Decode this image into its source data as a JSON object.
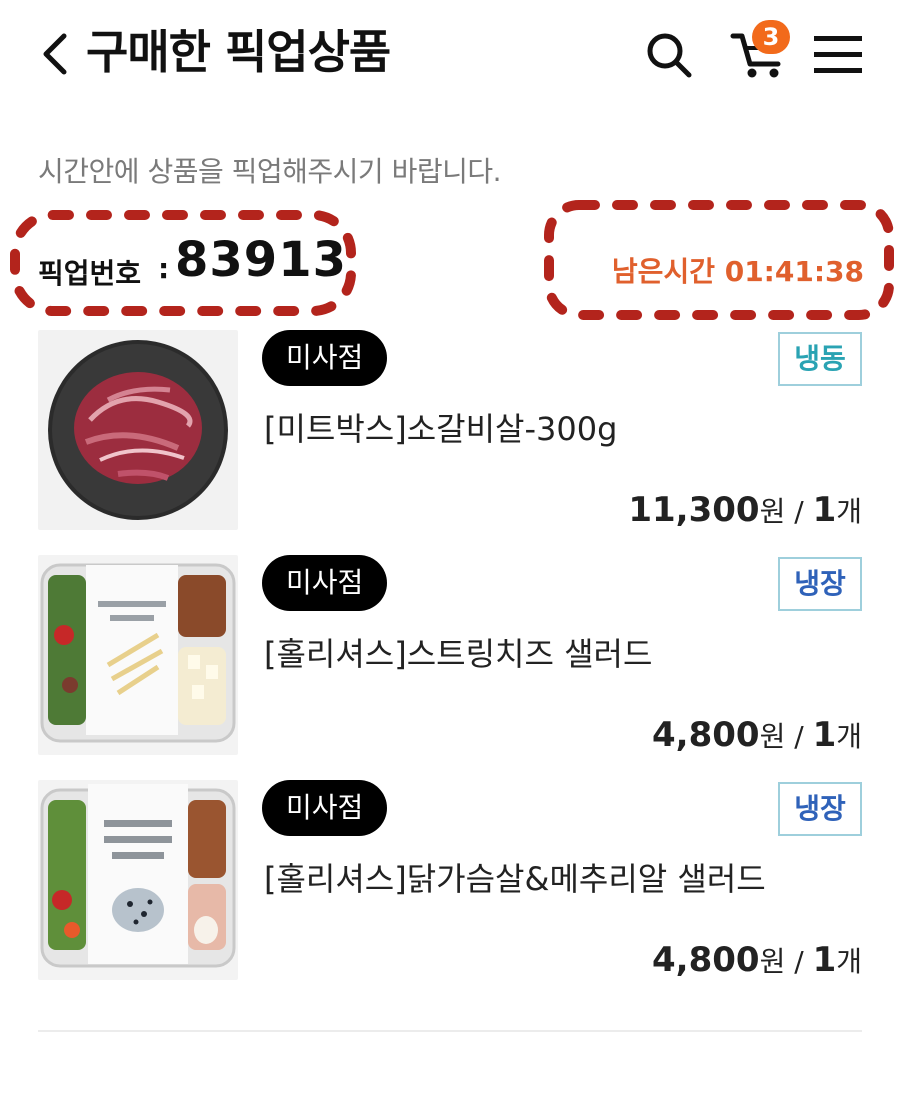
{
  "header": {
    "title": "구매한 픽업상품",
    "cart_count": "3"
  },
  "notice": "시간안에 상품을 픽업해주시기 바랍니다.",
  "pickup": {
    "label": "픽업번호",
    "colon": ":",
    "number": "83913"
  },
  "timer": {
    "text": "남은시간 01:41:38"
  },
  "colors": {
    "accent_orange": "#e0602d",
    "badge": "#f26a1b",
    "highlight_dashes": "#b3241c"
  },
  "products": [
    {
      "status": "미사점",
      "temp": "냉동",
      "name": "[미트박스]소갈비살-300g",
      "price": "11,300",
      "currency": "원",
      "sep": " / ",
      "qty": "1",
      "unit": "개"
    },
    {
      "status": "미사점",
      "temp": "냉장",
      "name": "[홀리셔스]스트링치즈 샐러드",
      "price": "4,800",
      "currency": "원",
      "sep": " / ",
      "qty": "1",
      "unit": "개"
    },
    {
      "status": "미사점",
      "temp": "냉장",
      "name": "[홀리셔스]닭가슴살&메추리알 샐러드",
      "price": "4,800",
      "currency": "원",
      "sep": " / ",
      "qty": "1",
      "unit": "개"
    }
  ]
}
